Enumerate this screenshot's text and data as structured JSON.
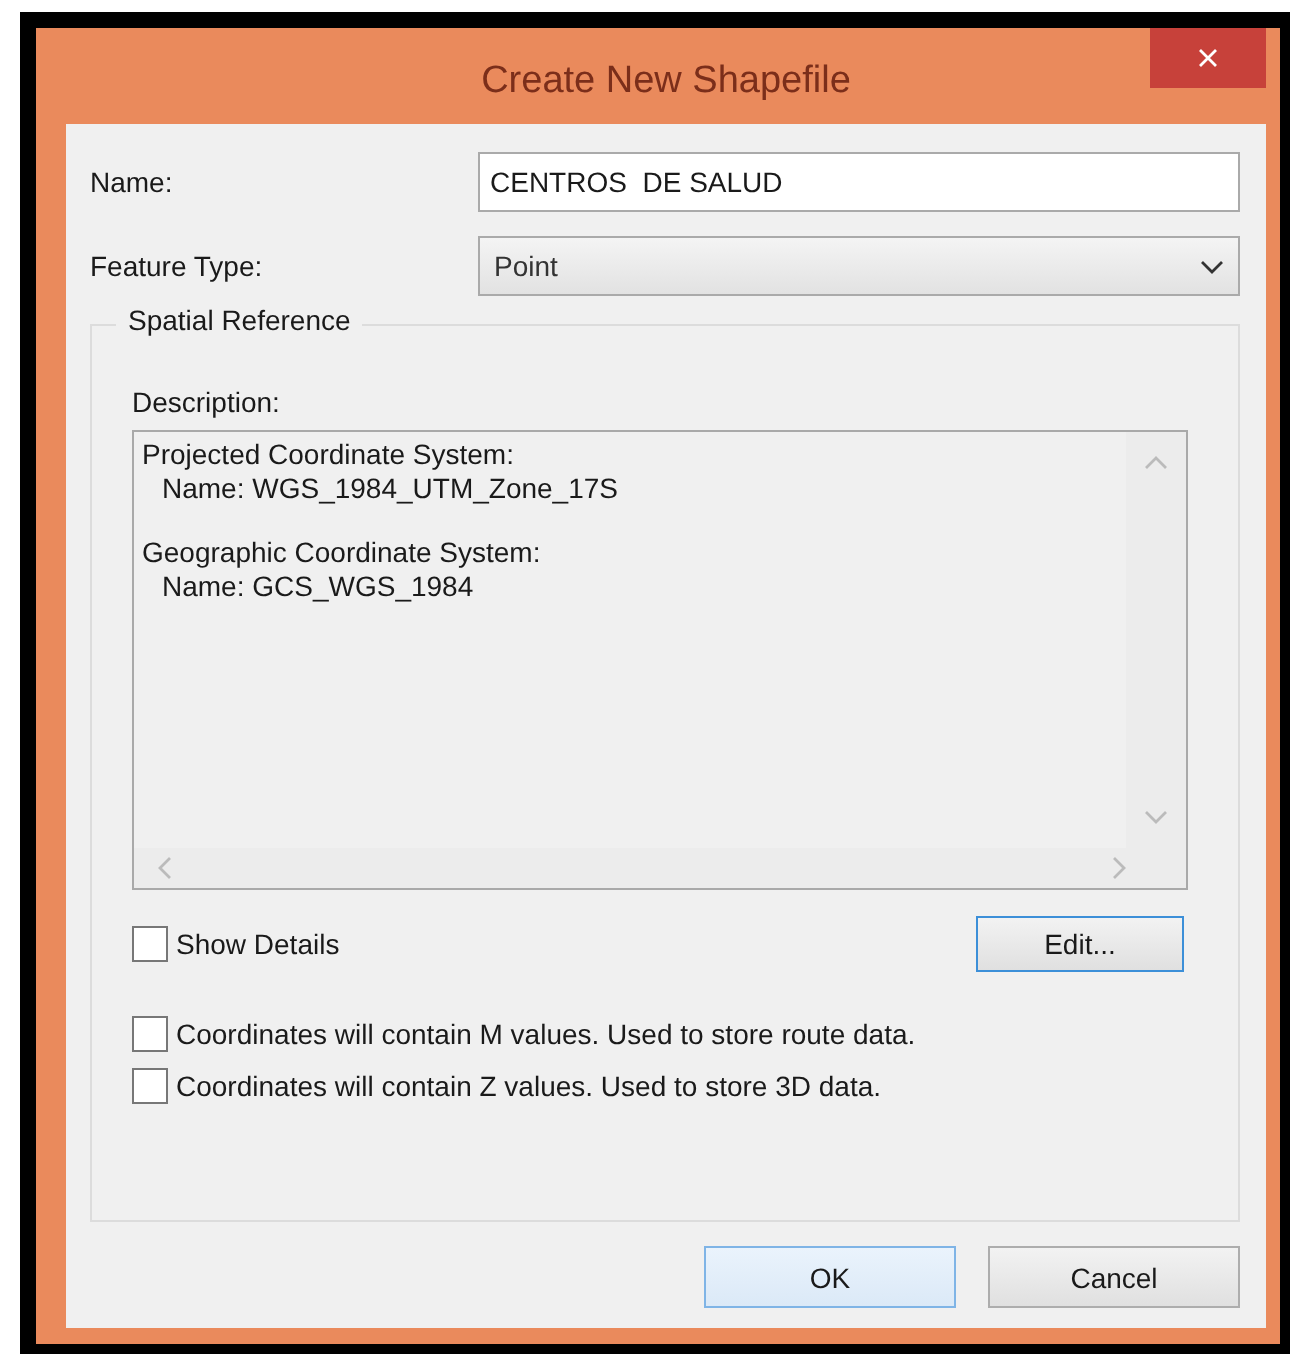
{
  "window": {
    "title": "Create New Shapefile"
  },
  "fields": [
    {
      "label": "Name:",
      "kind": "text",
      "value": "CENTROS  DE SALUD"
    },
    {
      "label": "Feature Type:",
      "kind": "dropdown",
      "value": "Point"
    }
  ],
  "spatial_reference": {
    "title": "Spatial Reference",
    "description_label": "Description:",
    "description": [
      {
        "heading": "Projected Coordinate System:",
        "detail": "Name: WGS_1984_UTM_Zone_17S"
      },
      {
        "heading": "Geographic Coordinate System:",
        "detail": "Name: GCS_WGS_1984"
      }
    ],
    "show_details": {
      "label": "Show Details",
      "checked": false
    },
    "edit_button": "Edit..."
  },
  "options": [
    {
      "label": "Coordinates will contain M values. Used to store route data.",
      "checked": false
    },
    {
      "label": "Coordinates will contain Z values. Used to store 3D data.",
      "checked": false
    }
  ],
  "buttons": [
    {
      "label": "OK",
      "default": true
    },
    {
      "label": "Cancel",
      "default": false
    }
  ]
}
